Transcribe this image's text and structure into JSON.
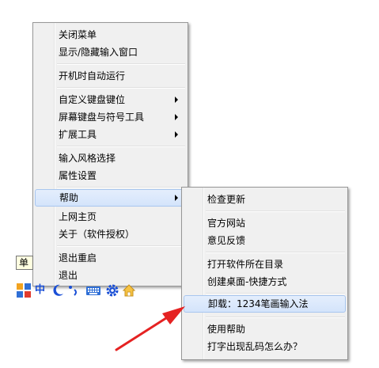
{
  "main_menu": {
    "items": [
      {
        "label": "关闭菜单"
      },
      {
        "label": "显示/隐藏输入窗口"
      },
      {
        "label": "开机时自动运行"
      },
      {
        "label": "自定义键盘键位"
      },
      {
        "label": "屏幕键盘与符号工具"
      },
      {
        "label": "扩展工具"
      },
      {
        "label": "输入风格选择"
      },
      {
        "label": "属性设置"
      },
      {
        "label": "帮助"
      },
      {
        "label": "上网主页"
      },
      {
        "label": "关于（软件授权）"
      },
      {
        "label": "退出重启"
      },
      {
        "label": "退出"
      }
    ]
  },
  "sub_menu": {
    "items": [
      {
        "label": "检查更新"
      },
      {
        "label": "官方网站"
      },
      {
        "label": "意见反馈"
      },
      {
        "label": "打开软件所在目录"
      },
      {
        "label": "创建桌面-快捷方式"
      },
      {
        "label": "卸载：1234笔画输入法"
      },
      {
        "label": "使用帮助"
      },
      {
        "label": "打字出现乱码怎么办？"
      }
    ]
  },
  "tooltip": {
    "text": "单"
  },
  "toolbar": {
    "mode_label": "中",
    "icons": [
      "logo-icon",
      "moon-icon",
      "punctuation-icon",
      "keyboard-icon",
      "gear-icon",
      "home-icon"
    ]
  },
  "colors": {
    "menu_bg": "#f0f0f0",
    "highlight_border": "#a8c6ef",
    "arrow_annotation": "#e52222",
    "toolbar_blue": "#1a4fd6"
  }
}
